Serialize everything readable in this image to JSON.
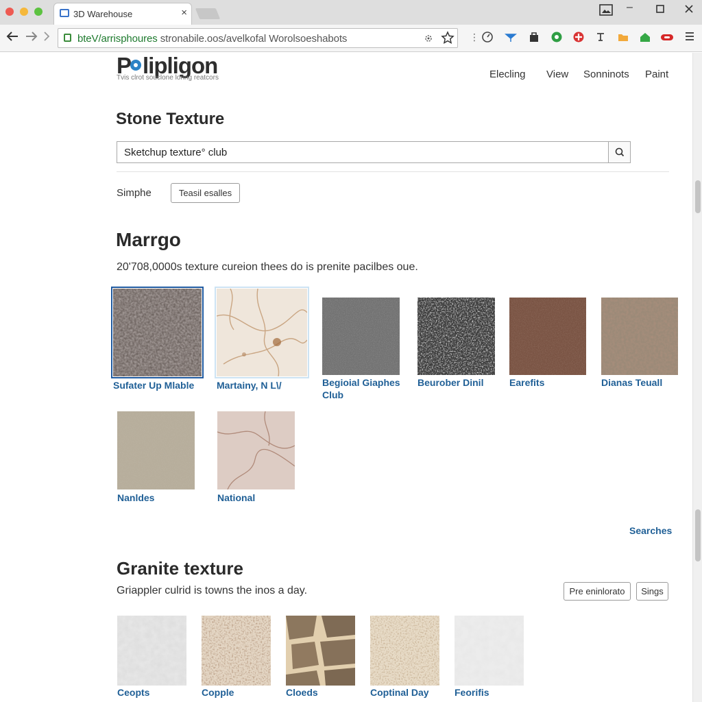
{
  "browser": {
    "tab_title": "3D Warehouse",
    "tab_close": "×",
    "url_host": "bteV/arrisphoures",
    "url_path": " stronabile.oos/avelkofal Worolsoeshabots"
  },
  "site": {
    "logo": "Polipligon",
    "tagline": "Tvis clrot souclone loring reatcors",
    "nav": [
      "Elecling",
      "View",
      "Sonninots",
      "Paint"
    ]
  },
  "stone": {
    "heading": "Stone Texture",
    "search_value": "Sketchup texture° club",
    "filter_label": "Simphe",
    "filter_button": "Teasil esalles"
  },
  "marble": {
    "heading": "Marrgo",
    "description": "20'708,0000s texture cureion thees do is prenite pacilbes oue.",
    "items": [
      {
        "caption": "Sufater Up Mlable",
        "state": "selected"
      },
      {
        "caption": "Martainy, N L\\/",
        "state": "hover"
      },
      {
        "caption": "Begioial Giaphes Club",
        "state": "normal"
      },
      {
        "caption": "Beurober Dinil",
        "state": "normal"
      },
      {
        "caption": "Earefits",
        "state": "normal"
      },
      {
        "caption": "Dianas Teuall",
        "state": "normal"
      },
      {
        "caption": "Nanldes",
        "state": "normal"
      },
      {
        "caption": "National",
        "state": "normal"
      }
    ],
    "more_link": "Searches"
  },
  "granite": {
    "heading": "Granite texture",
    "description": "Griappler culrid is towns the inos a day.",
    "button_primary": "Pre eninlorato",
    "button_secondary": "Sings",
    "items": [
      {
        "caption": "Ceopts"
      },
      {
        "caption": "Copple"
      },
      {
        "caption": "Cloeds"
      },
      {
        "caption": "Coptinal Day"
      },
      {
        "caption": "Feorifis"
      }
    ]
  },
  "icons": {
    "back": "arrow-left-icon",
    "forward": "arrow-right-icon",
    "search": "magnifier-icon",
    "bookmark": "star-icon"
  }
}
